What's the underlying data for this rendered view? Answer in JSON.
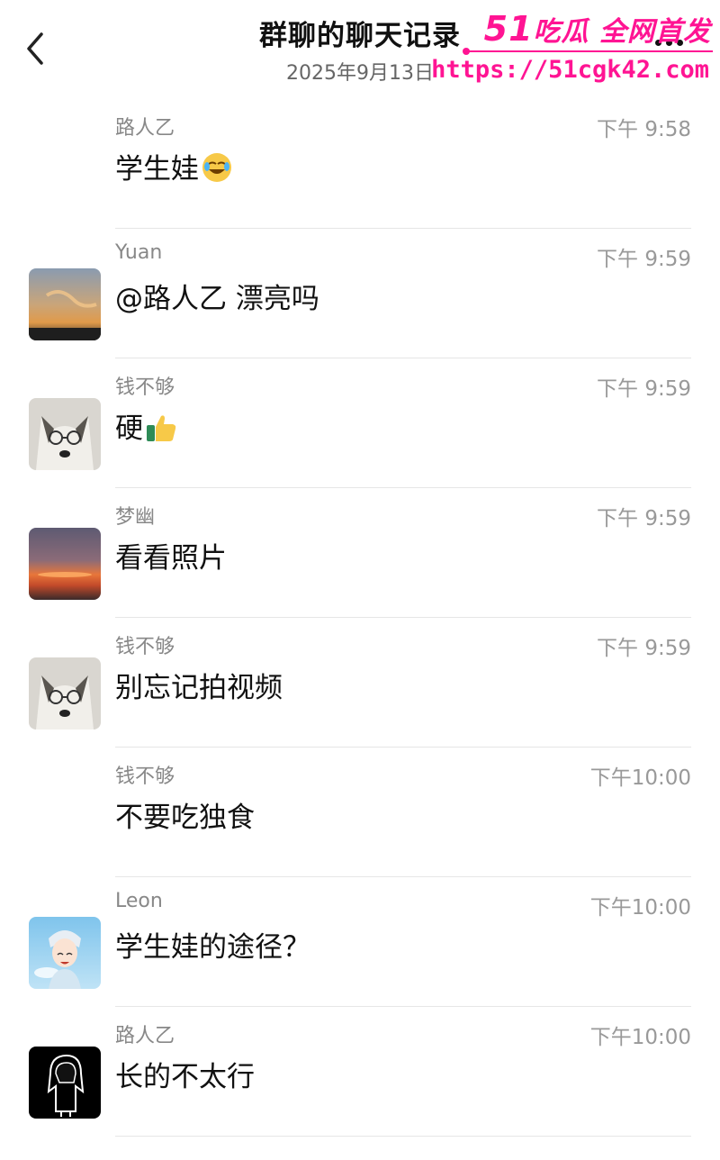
{
  "header": {
    "back_icon": "chevron-left-icon",
    "title": "群聊的聊天记录",
    "date": "2025年9月13日",
    "more_icon": "more-dots-icon"
  },
  "watermark": {
    "brand_num": "51",
    "brand_text": "吃瓜 全网首发",
    "url": "https://51cgk42.com",
    "color": "#ff1493"
  },
  "messages": [
    {
      "sender": "路人乙",
      "time": "下午 9:58",
      "text": "学生娃",
      "emoji": "rolling-laugh-emoji",
      "avatar": "none"
    },
    {
      "sender": "Yuan",
      "time": "下午 9:59",
      "text": "@路人乙 漂亮吗",
      "emoji": "",
      "avatar": "sky-photo"
    },
    {
      "sender": "钱不够",
      "time": "下午 9:59",
      "text": "硬",
      "emoji": "thumbs-up-emoji",
      "avatar": "husky-dog"
    },
    {
      "sender": "梦幽",
      "time": "下午 9:59",
      "text": "看看照片",
      "emoji": "",
      "avatar": "sunset-photo"
    },
    {
      "sender": "钱不够",
      "time": "下午 9:59",
      "text": "别忘记拍视频",
      "emoji": "",
      "avatar": "husky-dog"
    },
    {
      "sender": "钱不够",
      "time": "下午10:00",
      "text": "不要吃独食",
      "emoji": "",
      "avatar": "none"
    },
    {
      "sender": "Leon",
      "time": "下午10:00",
      "text": "学生娃的途径？",
      "emoji": "",
      "avatar": "anime-boy"
    },
    {
      "sender": "路人乙",
      "time": "下午10:00",
      "text": "长的不太行",
      "emoji": "",
      "avatar": "hooded-figure"
    }
  ]
}
